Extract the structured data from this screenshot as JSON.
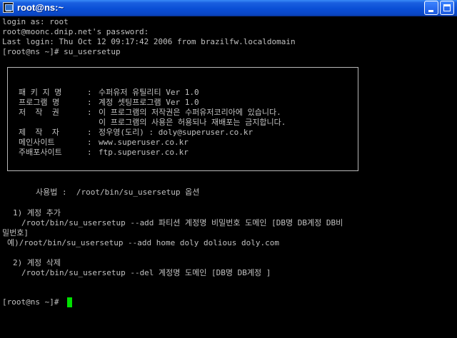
{
  "window": {
    "title": "root@ns:~",
    "buttons": {
      "minimize": "minimize-icon",
      "maximize": "maximize-icon"
    }
  },
  "terminal": {
    "login_as": "login as: root",
    "password_prompt": "root@moonc.dnip.net's password:",
    "last_login": "Last login: Thu Oct 12 09:17:42 2006 from brazilfw.localdomain",
    "command": "[root@ns ~]# su_usersetup",
    "box": {
      "rows": [
        {
          "label": "패 키 지 명",
          "sep": ":",
          "value": "수퍼유저 유틸리티 Ver 1.0"
        },
        {
          "label": "프로그램 명",
          "sep": ":",
          "value": "계정 셋팅프로그램 Ver 1.0"
        },
        {
          "label": "저  작  권",
          "sep": ":",
          "value": "이 프로그램의 저작권은 수퍼유저코리아에 있습니다."
        },
        {
          "label": "",
          "sep": "",
          "value": "이 프로그램의 사용은 허용되나 재배포는 금지합니다."
        },
        {
          "label": "제  작  자",
          "sep": ":",
          "value": "정우영(도리) : doly@superuser.co.kr"
        },
        {
          "label": "메인사이트",
          "sep": ":",
          "value": "www.superuser.co.kr"
        },
        {
          "label": "주배포사이트",
          "sep": ":",
          "value": "ftp.superuser.co.kr"
        }
      ]
    },
    "usage": "사용법 :  /root/bin/su_usersetup 옵션",
    "section1_title": "1) 계정 추가",
    "section1_syntax_1": "/root/bin/su_usersetup --add 파티션 계정명 비밀번호 도메인 [DB명 DB계정 DB비",
    "section1_syntax_2": "밀번호]",
    "section1_example": "예)/root/bin/su_usersetup --add home doly dolious doly.com",
    "section2_title": "2) 계정 삭제",
    "section2_syntax": "/root/bin/su_usersetup --del 계정명 도메인 [DB명 DB계정 ]",
    "final_prompt": "[root@ns ~]#"
  },
  "colors": {
    "titlebar": "#0a4fd6",
    "background": "#000000",
    "text": "#c0c0c0",
    "cursor": "#00e000"
  }
}
